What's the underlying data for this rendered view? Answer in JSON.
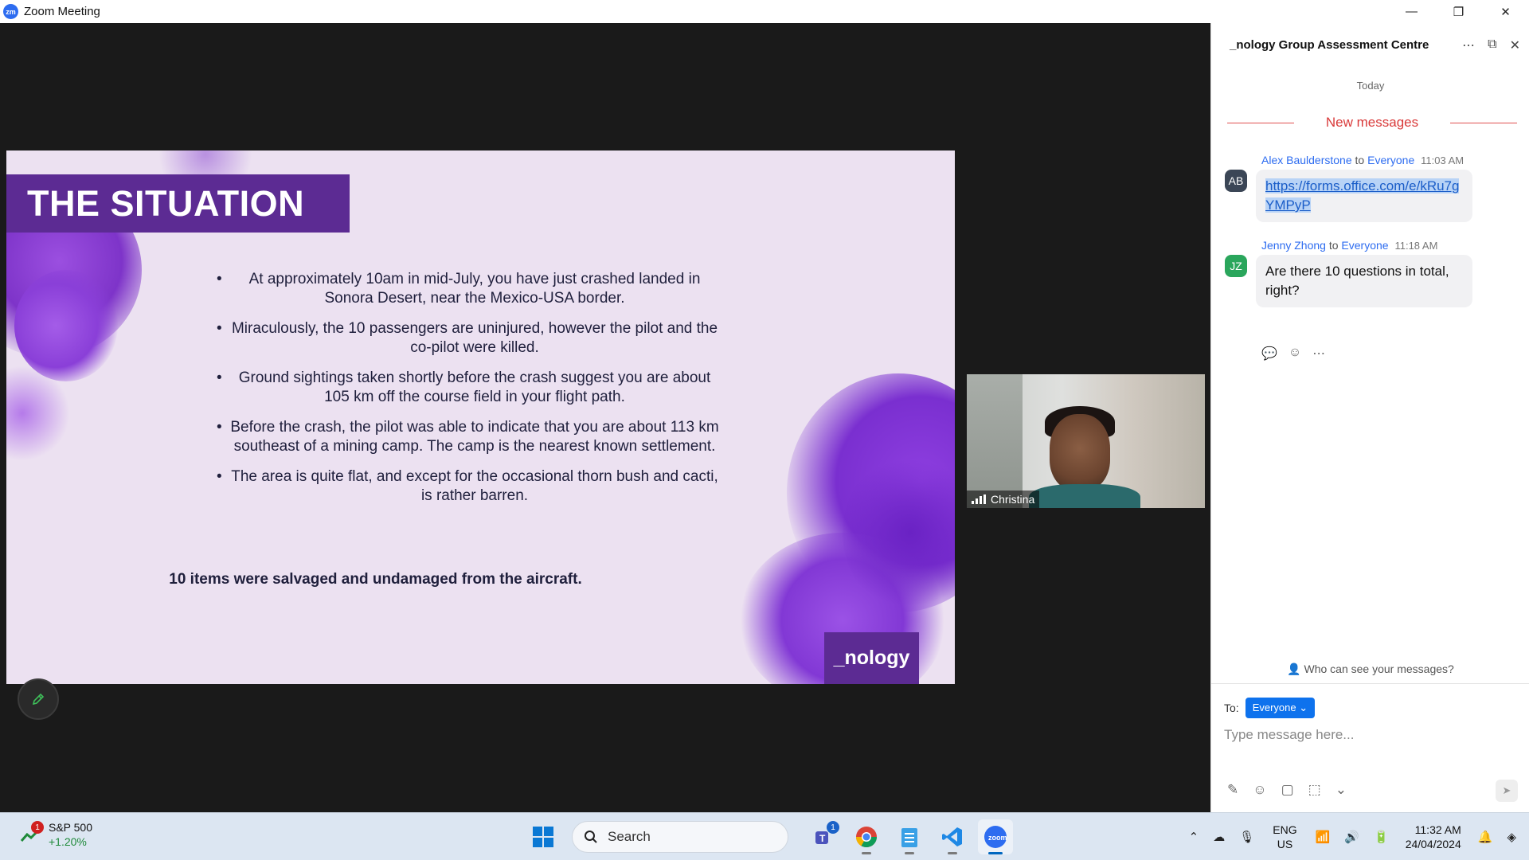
{
  "window": {
    "title": "Zoom Meeting",
    "app_icon": "zm"
  },
  "window_controls": {
    "minimize": "—",
    "restore": "❐",
    "close": "✕"
  },
  "slide": {
    "title": "THE SITUATION",
    "bullets": [
      "At approximately 10am in mid-July, you have just crashed landed in Sonora Desert, near the Mexico-USA border.",
      "Miraculously, the 10 passengers are uninjured, however the pilot and the co-pilot were killed.",
      "Ground sightings taken shortly before the crash suggest you are about 105 km off the course field in your flight path.",
      "Before the crash, the pilot was able to indicate that you are about 113 km southeast of a mining camp. The camp is the nearest known settlement.",
      "The area is quite flat, and except for the occasional thorn bush and cacti, is rather barren."
    ],
    "footer": "10 items were salvaged and undamaged from the aircraft.",
    "brand": "_nology",
    "accent_color": "#5c2b93"
  },
  "video": {
    "participant_name": "Christina"
  },
  "chat": {
    "title": "_nology Group Assessment Centre",
    "day_label": "Today",
    "new_messages_label": "New messages",
    "messages": [
      {
        "initials": "AB",
        "sender": "Alex Baulderstone",
        "to_word": "to",
        "recipient": "Everyone",
        "time": "11:03 AM",
        "text": "https://forms.office.com/e/kRu7gYMPyP",
        "avatar_color": "#3b4656"
      },
      {
        "initials": "JZ",
        "sender": "Jenny Zhong",
        "to_word": "to",
        "recipient": "Everyone",
        "time": "11:18 AM",
        "text": "Are there 10 questions in total, right?",
        "avatar_color": "#2aa65c"
      }
    ],
    "who_can_see": "Who can see your messages?",
    "to_label": "To:",
    "to_value": "Everyone",
    "input_placeholder": "Type message here..."
  },
  "taskbar": {
    "widget_badge": "1",
    "widget_name": "S&P 500",
    "widget_change": "+1.20%",
    "search_label": "Search",
    "teams_badge": "1",
    "lang_line1": "ENG",
    "lang_line2": "US",
    "time": "11:32 AM",
    "date": "24/04/2024"
  }
}
